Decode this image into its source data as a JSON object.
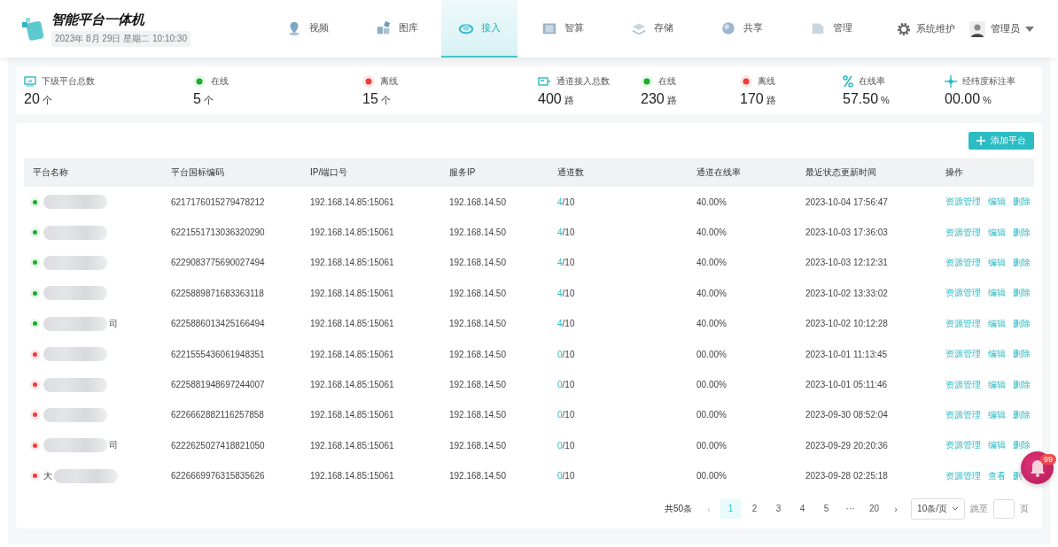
{
  "app": {
    "title": "智能平台一体机",
    "datetime": "2023年 8月 29日  星期二  10:10:30"
  },
  "nav": [
    {
      "label": "视频",
      "selected": false
    },
    {
      "label": "图库",
      "selected": false
    },
    {
      "label": "接入",
      "selected": true
    },
    {
      "label": "智算",
      "selected": false
    },
    {
      "label": "存储",
      "selected": false
    },
    {
      "label": "共享",
      "selected": false
    },
    {
      "label": "管理",
      "selected": false
    }
  ],
  "system": {
    "label": "系统维护"
  },
  "user": {
    "label": "管理员"
  },
  "stats": [
    {
      "kind": "monitor",
      "label": "下级平台总数",
      "value": "20",
      "unit": "个"
    },
    {
      "kind": "online",
      "label": "在线",
      "value": "5",
      "unit": "个"
    },
    {
      "kind": "offline",
      "label": "离线",
      "value": "15",
      "unit": "个"
    },
    {
      "kind": "channel",
      "label": "通道接入总数",
      "value": "400",
      "unit": "路"
    },
    {
      "kind": "online",
      "label": "在线",
      "value": "230",
      "unit": "路"
    },
    {
      "kind": "offline",
      "label": "离线",
      "value": "170",
      "unit": "路"
    },
    {
      "kind": "percent",
      "label": "在线率",
      "value": "57.50",
      "unit": "%"
    },
    {
      "kind": "geo",
      "label": "经纬度标注率",
      "value": "00.00",
      "unit": "%"
    }
  ],
  "add_button": "添加平台",
  "table": {
    "columns": [
      "平台名称",
      "平台国标编码",
      "IP/端口号",
      "服务IP",
      "通道数",
      "通道在线率",
      "最近状态更新时间",
      "操作"
    ],
    "rows": [
      {
        "online": true,
        "code": "6217176015279478212",
        "ip": "192.168.14.85:15061",
        "service_ip": "192.168.14.50",
        "channels_on": "4",
        "channels_total": "/10",
        "rate": "40.00%",
        "updated": "2023-10-04 17:56:47",
        "actions": [
          "资源管理",
          "编辑",
          "删除"
        ]
      },
      {
        "online": true,
        "code": "6221551713036320290",
        "ip": "192.168.14.85:15061",
        "service_ip": "192.168.14.50",
        "channels_on": "4",
        "channels_total": "/10",
        "rate": "40.00%",
        "updated": "2023-10-03 17:36:03",
        "actions": [
          "资源管理",
          "编辑",
          "删除"
        ]
      },
      {
        "online": true,
        "code": "6229083775690027494",
        "ip": "192.168.14.85:15061",
        "service_ip": "192.168.14.50",
        "channels_on": "4",
        "channels_total": "/10",
        "rate": "40.00%",
        "updated": "2023-10-03 12:12:31",
        "actions": [
          "资源管理",
          "编辑",
          "删除"
        ]
      },
      {
        "online": true,
        "code": "6225889871683363118",
        "ip": "192.168.14.85:15061",
        "service_ip": "192.168.14.50",
        "channels_on": "4",
        "channels_total": "/10",
        "rate": "40.00%",
        "updated": "2023-10-02 13:33:02",
        "actions": [
          "资源管理",
          "编辑",
          "删除"
        ]
      },
      {
        "online": true,
        "name_suffix": "司",
        "code": "6225886013425166494",
        "ip": "192.168.14.85:15061",
        "service_ip": "192.168.14.50",
        "channels_on": "4",
        "channels_total": "/10",
        "rate": "40.00%",
        "updated": "2023-10-02 10:12:28",
        "actions": [
          "资源管理",
          "编辑",
          "删除"
        ]
      },
      {
        "online": false,
        "code": "6221555436061948351",
        "ip": "192.168.14.85:15061",
        "service_ip": "192.168.14.50",
        "channels_on": "0",
        "channels_total": "/10",
        "rate": "00.00%",
        "updated": "2023-10-01 11:13:45",
        "actions": [
          "资源管理",
          "编辑",
          "删除"
        ]
      },
      {
        "online": false,
        "code": "6225881948697244007",
        "ip": "192.168.14.85:15061",
        "service_ip": "192.168.14.50",
        "channels_on": "0",
        "channels_total": "/10",
        "rate": "00.00%",
        "updated": "2023-10-01 05:11:46",
        "actions": [
          "资源管理",
          "编辑",
          "删除"
        ]
      },
      {
        "online": false,
        "code": "6226662882116257858",
        "ip": "192.168.14.85:15061",
        "service_ip": "192.168.14.50",
        "channels_on": "0",
        "channels_total": "/10",
        "rate": "00.00%",
        "updated": "2023-09-30 08:52:04",
        "actions": [
          "资源管理",
          "编辑",
          "删除"
        ]
      },
      {
        "online": false,
        "name_suffix": "司",
        "code": "6222625027418821050",
        "ip": "192.168.14.85:15061",
        "service_ip": "192.168.14.50",
        "channels_on": "0",
        "channels_total": "/10",
        "rate": "00.00%",
        "updated": "2023-09-29 20:20:36",
        "actions": [
          "资源管理",
          "编辑",
          "删除"
        ]
      },
      {
        "online": false,
        "name_prefix": "大",
        "code": "6226669976315835626",
        "ip": "192.168.14.85:15061",
        "service_ip": "192.168.14.50",
        "channels_on": "0",
        "channels_total": "/10",
        "rate": "00.00%",
        "updated": "2023-09-28 02:25:18",
        "actions": [
          "资源管理",
          "查看",
          "删"
        ]
      }
    ]
  },
  "pagination": {
    "total": "共50条",
    "prev": "‹",
    "next": "›",
    "pages": [
      {
        "label": "1",
        "selected": true
      },
      {
        "label": "2",
        "selected": false
      },
      {
        "label": "3",
        "selected": false
      },
      {
        "label": "4",
        "selected": false
      },
      {
        "label": "5",
        "selected": false
      },
      {
        "label": "···",
        "selected": false
      },
      {
        "label": "20",
        "selected": false
      }
    ],
    "page_size": "10条/页",
    "jump_label": "跳至",
    "page_unit": "页"
  },
  "notification": {
    "badge": "99"
  }
}
